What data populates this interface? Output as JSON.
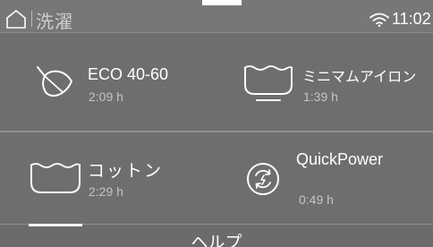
{
  "header": {
    "title": "洗濯",
    "time": "11:02",
    "icons": [
      "home-icon",
      "wifi-icon"
    ]
  },
  "programs": [
    {
      "id": "eco",
      "label": "ECO 40-60",
      "duration": "2:09 h",
      "icon": "leaf-icon"
    },
    {
      "id": "minimum-iron",
      "label": "ミニマムアイロン",
      "duration": "1:39 h",
      "icon": "washtub-icon"
    },
    {
      "id": "cotton",
      "label": "コットン",
      "duration": "2:29 h",
      "icon": "washtub-icon"
    },
    {
      "id": "quickpower",
      "label": "QuickPower",
      "duration": "0:49 h",
      "icon": "quickpower-icon"
    }
  ],
  "footer": {
    "help_label": "ヘルプ"
  },
  "colors": {
    "background": "#6e6e6e",
    "text": "#ffffff",
    "secondary_text": "#c4c4c4"
  }
}
